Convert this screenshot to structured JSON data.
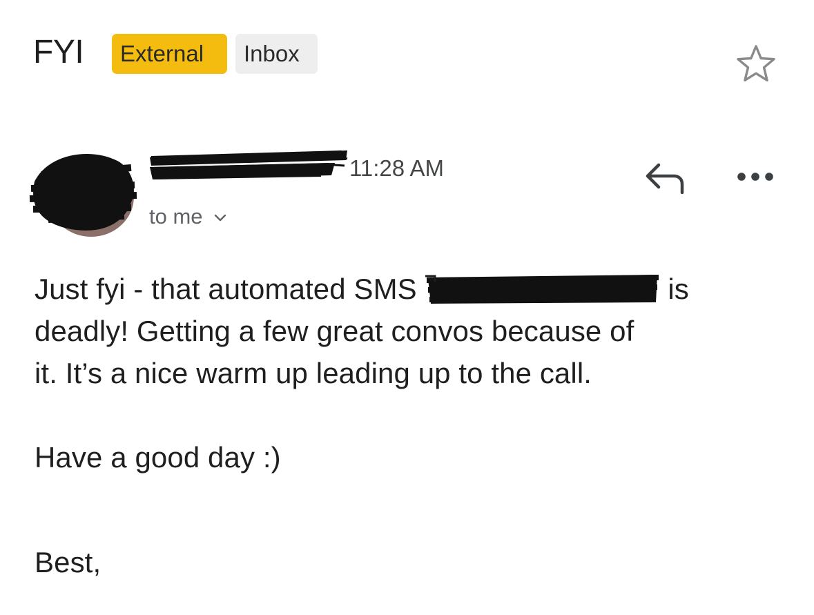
{
  "header": {
    "subject": "FYI",
    "labels": [
      {
        "text": "External",
        "color": "#f4bc0f"
      },
      {
        "text": "Inbox",
        "color": "#eeeeee"
      }
    ],
    "star_icon": "star-outline-icon"
  },
  "message": {
    "sender_name": "",
    "time": "11:28 AM",
    "recipient": "to me",
    "icons": {
      "reply": "reply-icon",
      "more": "more-horizontal-icon",
      "expand": "chevron-down-icon"
    },
    "body": {
      "line1_before": "Just fyi - that automated SMS ",
      "line1_after": " is",
      "line2": "deadly! Getting a few great convos because of",
      "line3": "it. It’s a nice warm up leading up to the call.",
      "line4": "Have a good day :)",
      "signoff": "Best,"
    }
  }
}
